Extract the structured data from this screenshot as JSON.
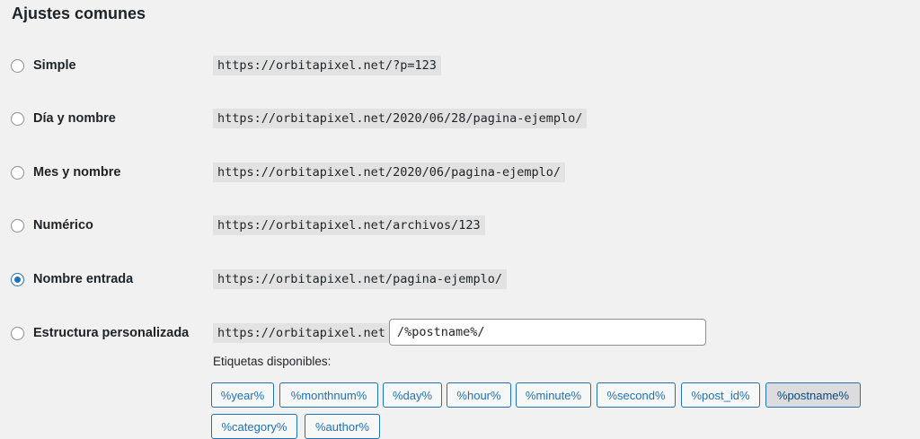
{
  "section": {
    "title": "Ajustes comunes"
  },
  "options": [
    {
      "label": "Simple",
      "example": "https://orbitapixel.net/?p=123",
      "checked": false
    },
    {
      "label": "Día y nombre",
      "example": "https://orbitapixel.net/2020/06/28/pagina-ejemplo/",
      "checked": false
    },
    {
      "label": "Mes y nombre",
      "example": "https://orbitapixel.net/2020/06/pagina-ejemplo/",
      "checked": false
    },
    {
      "label": "Numérico",
      "example": "https://orbitapixel.net/archivos/123",
      "checked": false
    },
    {
      "label": "Nombre entrada",
      "example": "https://orbitapixel.net/pagina-ejemplo/",
      "checked": true
    },
    {
      "label": "Estructura personalizada",
      "prefix": "https://orbitapixel.net",
      "value": "/%postname%/",
      "checked": false
    }
  ],
  "available_tags_label": "Etiquetas disponibles:",
  "tags": [
    {
      "label": "%year%",
      "active": false
    },
    {
      "label": "%monthnum%",
      "active": false
    },
    {
      "label": "%day%",
      "active": false
    },
    {
      "label": "%hour%",
      "active": false
    },
    {
      "label": "%minute%",
      "active": false
    },
    {
      "label": "%second%",
      "active": false
    },
    {
      "label": "%post_id%",
      "active": false
    },
    {
      "label": "%postname%",
      "active": true
    },
    {
      "label": "%category%",
      "active": false
    },
    {
      "label": "%author%",
      "active": false
    }
  ],
  "colors": {
    "accent": "#2271b1",
    "background": "#f1f1f1",
    "code_bg": "#e2e2e2"
  }
}
